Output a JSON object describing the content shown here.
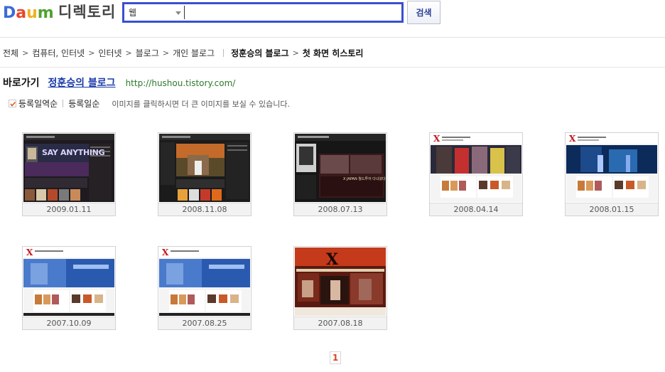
{
  "header": {
    "logo_letters": [
      {
        "ch": "D",
        "color": "#3b6bd6"
      },
      {
        "ch": "a",
        "color": "#e8442b"
      },
      {
        "ch": "u",
        "color": "#f2b01f"
      },
      {
        "ch": "m",
        "color": "#4ca32f"
      }
    ],
    "title": "디렉토리",
    "search_scope": "웹",
    "search_value": "",
    "search_button": "검색",
    "accent": "#3a4fcf"
  },
  "breadcrumb": {
    "items": [
      "전체",
      "컴퓨터, 인터넷",
      "인터넷",
      "블로그",
      "개인 블로그"
    ],
    "blog_name": "정훈승의 블로그",
    "current": "첫 화면 히스토리",
    "separator": ">"
  },
  "shortcut": {
    "label": "바로가기",
    "blog_link": "정훈승의 블로그",
    "url": "http://hushou.tistory.com/"
  },
  "sort": {
    "active": "등록일역순",
    "other": "등록일순",
    "hint": "이미지를 클릭하시면 더 큰 이미지를 보실 수 있습니다."
  },
  "gallery": [
    {
      "date": "2009.01.11",
      "theme": "dark-sayanything",
      "banner_text": "SAY ANYTHING"
    },
    {
      "date": "2008.11.08",
      "theme": "dark-autumn",
      "banner_text": ""
    },
    {
      "date": "2008.07.13",
      "theme": "dark-stage",
      "banner_text": "X JAPAN 월드투어 다녀왔다"
    },
    {
      "date": "2008.04.14",
      "theme": "xjapan-members",
      "banner_text": ""
    },
    {
      "date": "2008.01.15",
      "theme": "xjapan-concert",
      "banner_text": ""
    },
    {
      "date": "2007.10.09",
      "theme": "xjapan-blue",
      "banner_text": ""
    },
    {
      "date": "2007.08.25",
      "theme": "xjapan-blue",
      "banner_text": ""
    },
    {
      "date": "2007.08.18",
      "theme": "xjapan-red",
      "banner_text": ""
    }
  ],
  "pagination": {
    "current": "1"
  }
}
